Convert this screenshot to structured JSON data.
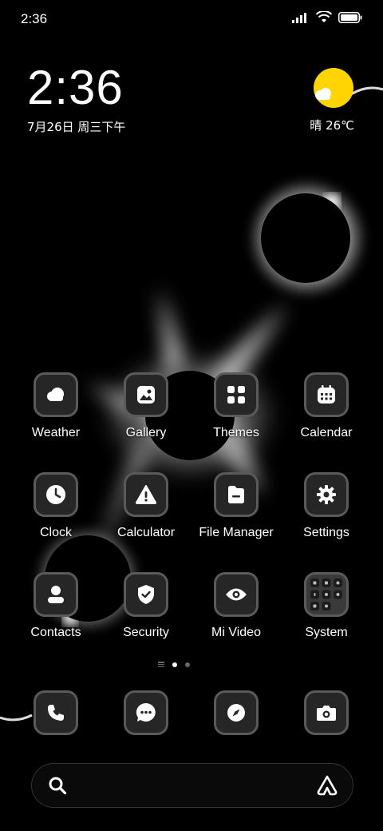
{
  "status_bar": {
    "time": "2:36",
    "icons": [
      "signal-icon",
      "wifi-icon",
      "battery-icon"
    ]
  },
  "clock_widget": {
    "time": "2:36",
    "date": "7月26日 周三下午"
  },
  "weather_widget": {
    "icon": "sun-cloud-icon",
    "condition_temp": "晴 26℃",
    "sun_color": "#ffd400"
  },
  "apps": [
    {
      "label": "Weather",
      "icon": "cloud-icon"
    },
    {
      "label": "Gallery",
      "icon": "image-icon"
    },
    {
      "label": "Themes",
      "icon": "grid-icon"
    },
    {
      "label": "Calendar",
      "icon": "calendar-icon"
    },
    {
      "label": "Clock",
      "icon": "clock-icon"
    },
    {
      "label": "Calculator",
      "icon": "warning-icon"
    },
    {
      "label": "File Manager",
      "icon": "folder-icon"
    },
    {
      "label": "Settings",
      "icon": "gear-icon"
    },
    {
      "label": "Contacts",
      "icon": "person-icon"
    },
    {
      "label": "Security",
      "icon": "shield-icon"
    },
    {
      "label": "Mi Video",
      "icon": "eye-icon"
    },
    {
      "label": "System",
      "icon": "folder-grid-icon"
    }
  ],
  "page_indicator": {
    "pages": 2,
    "active": 1
  },
  "dock": [
    {
      "icon": "phone-icon"
    },
    {
      "icon": "message-icon"
    },
    {
      "icon": "compass-icon"
    },
    {
      "icon": "camera-icon"
    }
  ],
  "search_bar": {
    "left_icon": "search-icon",
    "right_icon": "assistant-icon"
  }
}
